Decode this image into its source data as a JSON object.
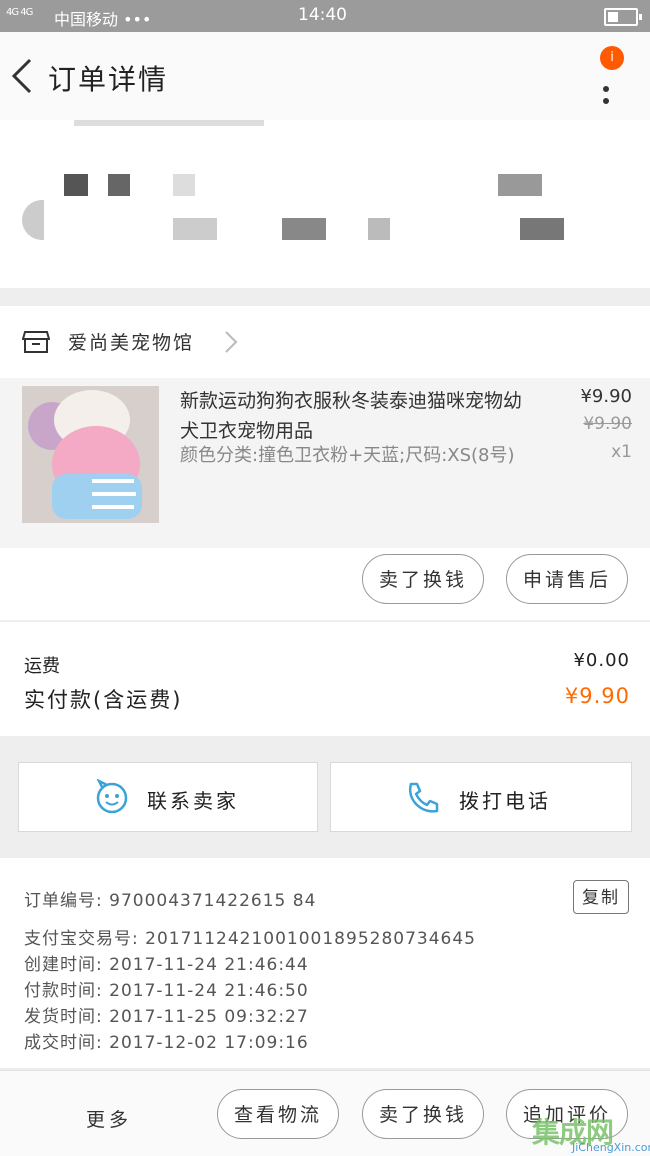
{
  "status_bar": {
    "signal": "4G 4G",
    "carrier": "中国移动 •••",
    "time": "14:40"
  },
  "header": {
    "title": "订单详情",
    "badge": "i"
  },
  "shop": {
    "name": "爱尚美宠物馆"
  },
  "item": {
    "title": "新款运动狗狗衣服秋冬装泰迪猫咪宠物幼犬卫衣宠物用品",
    "sku": "颜色分类:撞色卫衣粉+天蓝;尺码:XS(8号)",
    "price": "¥9.90",
    "original_price": "¥9.90",
    "quantity": "x1",
    "buttons": [
      "卖了换钱",
      "申请售后"
    ]
  },
  "totals": {
    "shipping_label": "运费",
    "shipping_value": "¥0.00",
    "paid_label": "实付款(含运费)",
    "paid_value": "¥9.90"
  },
  "contact": {
    "seller_label": "联系卖家",
    "call_label": "拨打电话"
  },
  "order_info": {
    "order_no": "订单编号: 970004371422615 84",
    "alipay_no": "支付宝交易号: 2017112421001001895280734645",
    "created": "创建时间: 2017-11-24 21:46:44",
    "paid": "付款时间: 2017-11-24 21:46:50",
    "shipped": "发货时间: 2017-11-25 09:32:27",
    "completed": "成交时间: 2017-12-02 17:09:16",
    "copy_label": "复制"
  },
  "bottom_bar": {
    "more_label": "更多",
    "logistics_label": "查看物流",
    "sell_label": "卖了换钱",
    "review_label": "追加评价"
  },
  "watermark": {
    "text": "集成网",
    "url": "JiChengXin.com"
  },
  "colors": {
    "accent": "#ff6a00",
    "badge": "#ff5a00",
    "icon_blue": "#3aa3d8"
  }
}
